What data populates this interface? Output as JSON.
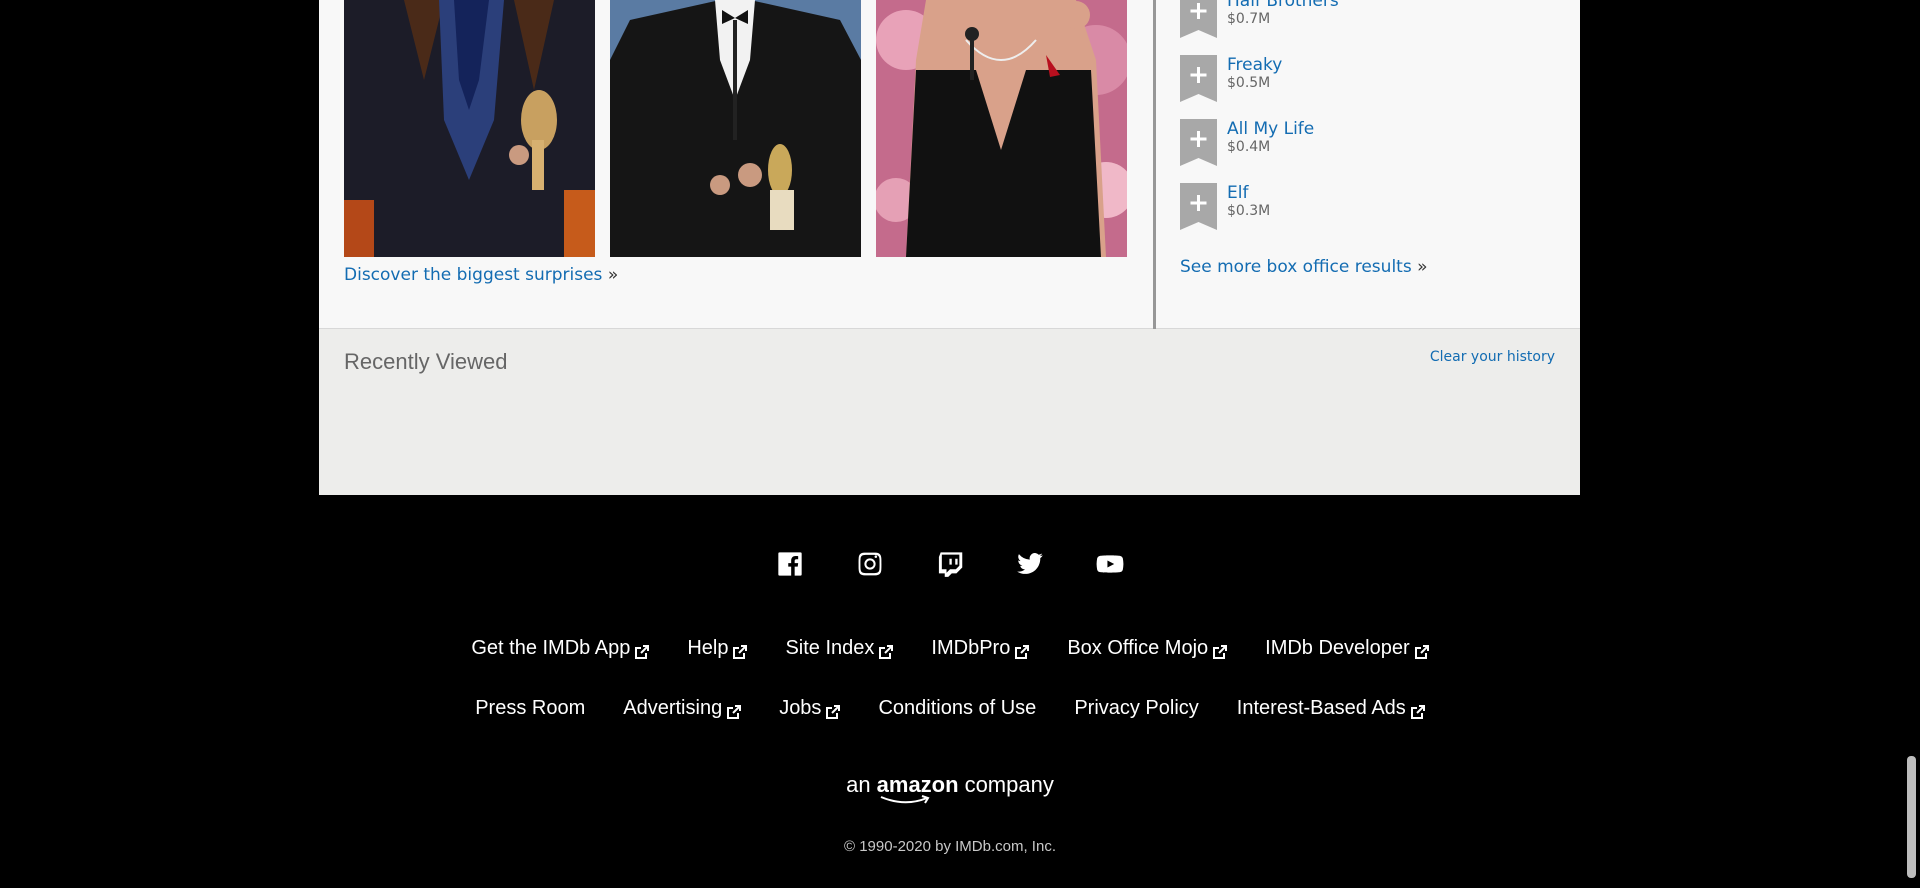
{
  "discover": {
    "label": "Discover the biggest surprises",
    "raquo": "»"
  },
  "box_office": {
    "items": [
      {
        "title": "Half Brothers",
        "gross": "$0.7M"
      },
      {
        "title": "Freaky",
        "gross": "$0.5M"
      },
      {
        "title": "All My Life",
        "gross": "$0.4M"
      },
      {
        "title": "Elf",
        "gross": "$0.3M"
      }
    ],
    "see_more": "See more box office results",
    "raquo": "»"
  },
  "recently_viewed": {
    "title": "Recently Viewed",
    "clear": "Clear your history"
  },
  "social": [
    "facebook-icon",
    "instagram-icon",
    "twitch-icon",
    "twitter-icon",
    "youtube-icon"
  ],
  "footer": {
    "row1": [
      {
        "label": "Get the IMDb App",
        "external": true
      },
      {
        "label": "Help",
        "external": true
      },
      {
        "label": "Site Index",
        "external": true
      },
      {
        "label": "IMDbPro",
        "external": true
      },
      {
        "label": "Box Office Mojo",
        "external": true
      },
      {
        "label": "IMDb Developer",
        "external": true
      }
    ],
    "row2": [
      {
        "label": "Press Room",
        "external": false
      },
      {
        "label": "Advertising",
        "external": true
      },
      {
        "label": "Jobs",
        "external": true
      },
      {
        "label": "Conditions of Use",
        "external": false
      },
      {
        "label": "Privacy Policy",
        "external": false
      },
      {
        "label": "Interest-Based Ads",
        "external": true
      }
    ],
    "amazon_prefix": "an",
    "amazon_word": "amazon",
    "amazon_suffix": "company",
    "copyright": "© 1990-2020 by IMDb.com, Inc."
  },
  "colors": {
    "link": "#136cb2",
    "background": "#000000",
    "panel": "#f8f8f8",
    "recent_bg": "#ededeb"
  }
}
